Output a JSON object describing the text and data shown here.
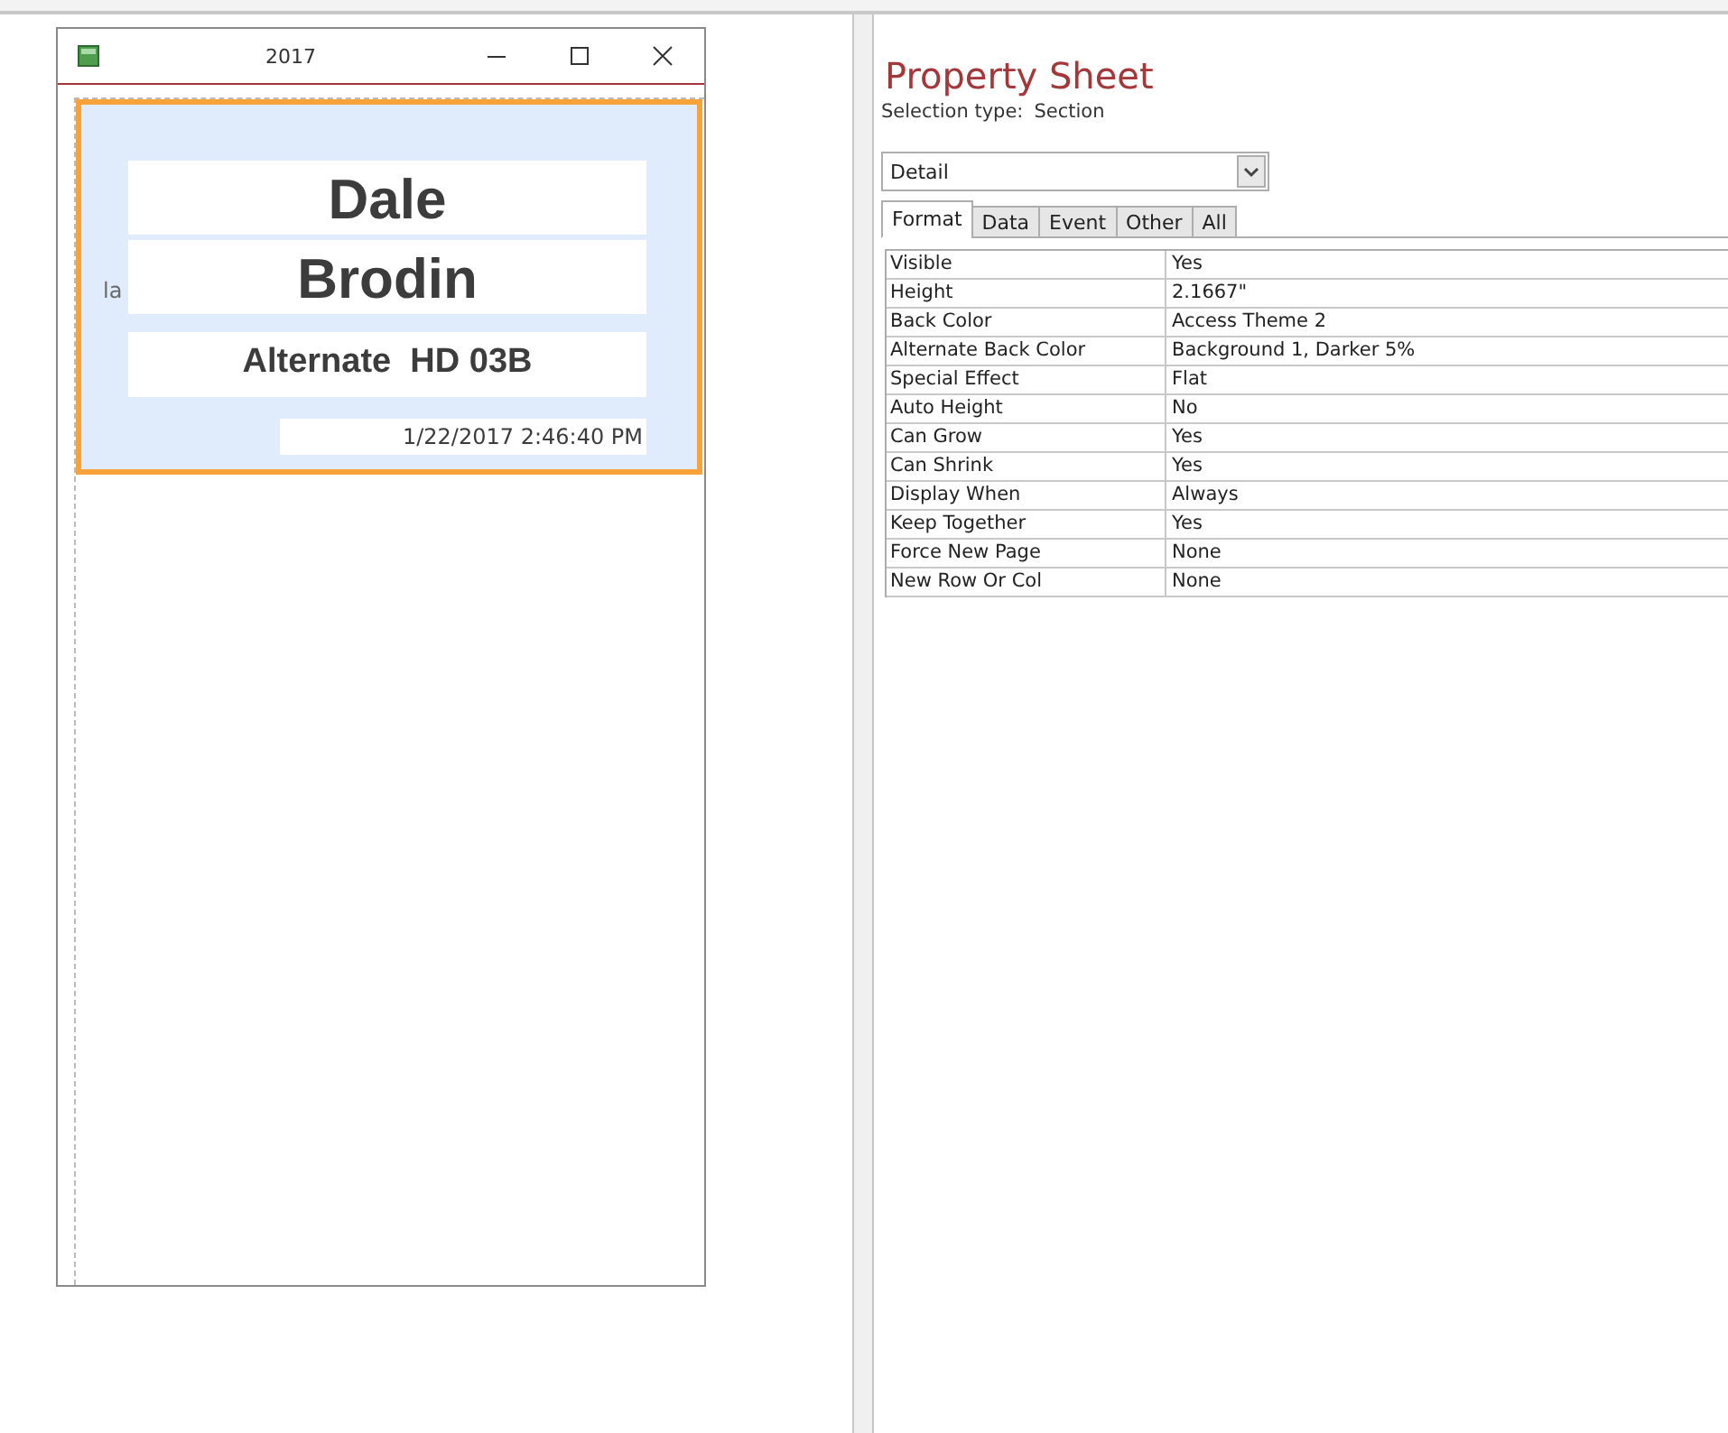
{
  "form_window": {
    "title": "2017",
    "hidden_label": "la",
    "fields": [
      {
        "kind": "large",
        "value": "Dale"
      },
      {
        "kind": "large",
        "value": "Brodin"
      },
      {
        "kind": "medium",
        "value": "Alternate  HD 03B"
      },
      {
        "kind": "date",
        "value": "1/22/2017 2:46:40 PM"
      }
    ]
  },
  "property_sheet": {
    "title": "Property Sheet",
    "selection_type_label": "Selection type:",
    "selection_type": "Section",
    "object_dropdown": "Detail",
    "tabs": [
      {
        "label": "Format",
        "selected": true
      },
      {
        "label": "Data",
        "selected": false
      },
      {
        "label": "Event",
        "selected": false
      },
      {
        "label": "Other",
        "selected": false
      },
      {
        "label": "All",
        "selected": false
      }
    ],
    "properties": [
      {
        "name": "Visible",
        "value": "Yes"
      },
      {
        "name": "Height",
        "value": "2.1667\""
      },
      {
        "name": "Back Color",
        "value": "Access Theme 2"
      },
      {
        "name": "Alternate Back Color",
        "value": "Background 1, Darker 5%"
      },
      {
        "name": "Special Effect",
        "value": "Flat"
      },
      {
        "name": "Auto Height",
        "value": "No"
      },
      {
        "name": "Can Grow",
        "value": "Yes"
      },
      {
        "name": "Can Shrink",
        "value": "Yes"
      },
      {
        "name": "Display When",
        "value": "Always"
      },
      {
        "name": "Keep Together",
        "value": "Yes"
      },
      {
        "name": "Force New Page",
        "value": "None"
      },
      {
        "name": "New Row Or Col",
        "value": "None"
      }
    ]
  }
}
